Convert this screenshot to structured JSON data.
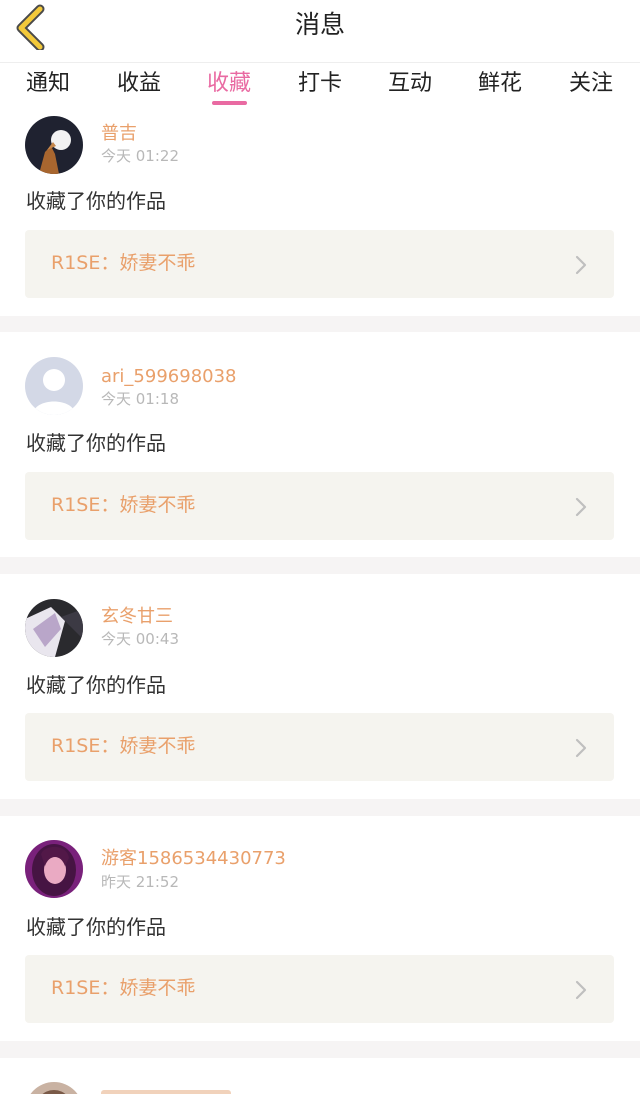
{
  "header": {
    "title": "消息",
    "back_icon": "chevron-left-icon"
  },
  "tabs": [
    {
      "label": "通知",
      "active": false
    },
    {
      "label": "收益",
      "active": false
    },
    {
      "label": "收藏",
      "active": true
    },
    {
      "label": "打卡",
      "active": false
    },
    {
      "label": "互动",
      "active": false
    },
    {
      "label": "鲜花",
      "active": false
    },
    {
      "label": "关注",
      "active": false
    }
  ],
  "colors": {
    "accent_tab": "#e96aa2",
    "username": "#e9a06b",
    "work_title": "#e9a06b",
    "work_box_bg": "#f5f4ef",
    "page_bg": "#f6f4f4"
  },
  "notifications": [
    {
      "username": "普吉",
      "time": "今天 01:22",
      "action": "收藏了你的作品",
      "work_title": "R1SE：娇妻不乖",
      "avatar": "dark-photo-avatar"
    },
    {
      "username": "ari_599698038",
      "time": "今天 01:18",
      "action": "收藏了你的作品",
      "work_title": "R1SE：娇妻不乖",
      "avatar": "default-user-avatar"
    },
    {
      "username": "玄冬甘三",
      "time": "今天 00:43",
      "action": "收藏了你的作品",
      "work_title": "R1SE：娇妻不乖",
      "avatar": "photo-avatar"
    },
    {
      "username": "游客1586534430773",
      "time": "昨天 21:52",
      "action": "收藏了你的作品",
      "work_title": "R1SE：娇妻不乖",
      "avatar": "girl-photo-avatar"
    }
  ]
}
